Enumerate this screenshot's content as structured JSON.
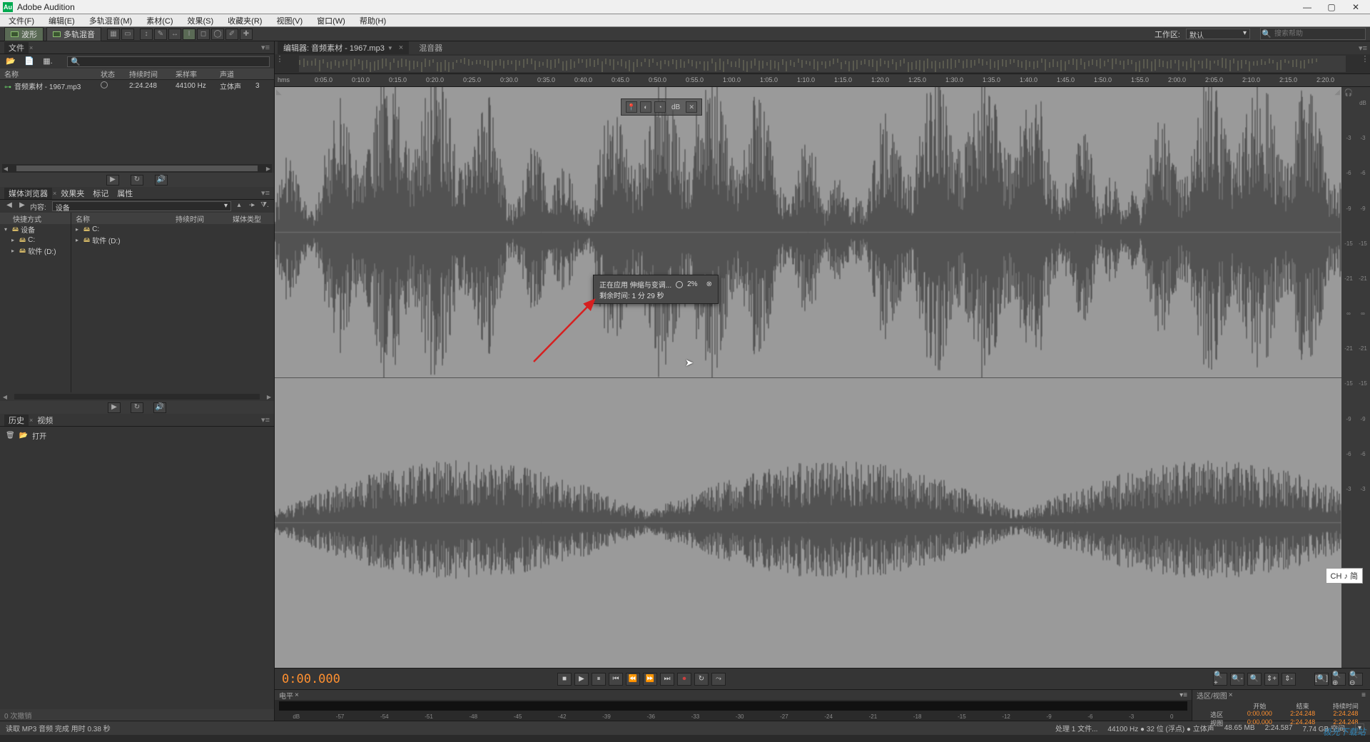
{
  "app": {
    "title": "Adobe Audition",
    "logo": "Au"
  },
  "menu": {
    "items": [
      "文件(F)",
      "编辑(E)",
      "多轨混音(M)",
      "素材(C)",
      "效果(S)",
      "收藏夹(R)",
      "视图(V)",
      "窗口(W)",
      "帮助(H)"
    ]
  },
  "mode": {
    "waveform": "波形",
    "multitrack": "多轨混音",
    "workspace_lbl": "工作区:",
    "workspace_val": "默认",
    "search_ph": "搜索帮助"
  },
  "files": {
    "panel": "文件",
    "cols": {
      "name": "名称",
      "status": "状态",
      "dur": "持续时间",
      "sr": "采样率",
      "ch": "声道"
    },
    "row": {
      "name": "音频素材 - 1967.mp3",
      "dur": "2:24.248",
      "sr": "44100 Hz",
      "ch": "立体声",
      "lvl": "3"
    }
  },
  "mbrowser": {
    "tabs": [
      "媒体浏览器",
      "效果夹",
      "标记",
      "属性"
    ],
    "content_lbl": "内容:",
    "content_val": "设备",
    "tree_hdr": "快捷方式",
    "list_name": "名称",
    "list_dur": "持续时间",
    "list_type": "媒体类型",
    "tree": [
      "设备",
      "C:",
      "软件 (D:)"
    ],
    "list": [
      "C:",
      "软件 (D:)"
    ]
  },
  "history": {
    "tabs": [
      "历史",
      "视频"
    ],
    "item": "打开",
    "undo": "0 次撤销"
  },
  "editor": {
    "title_prefix": "编辑器: ",
    "filename": "音频素材 - 1967.mp3",
    "mixer": "混音器",
    "ruler": [
      "hms",
      "0:05.0",
      "0:10.0",
      "0:15.0",
      "0:20.0",
      "0:25.0",
      "0:30.0",
      "0:35.0",
      "0:40.0",
      "0:45.0",
      "0:50.0",
      "0:55.0",
      "1:00.0",
      "1:05.0",
      "1:10.0",
      "1:15.0",
      "1:20.0",
      "1:25.0",
      "1:30.0",
      "1:35.0",
      "1:40.0",
      "1:45.0",
      "1:50.0",
      "1:55.0",
      "2:00.0",
      "2:05.0",
      "2:10.0",
      "2:15.0",
      "2:20.0"
    ],
    "db_marks": [
      "dB",
      "-3",
      "-6",
      "-9",
      "-15",
      "-21",
      "∞",
      "-21",
      "-15",
      "-9",
      "-6",
      "-3"
    ],
    "hud_txt": "dB"
  },
  "progress": {
    "line1": "正在应用 伸缩与变调...",
    "pct": "2%",
    "line2": "剩余时间: 1 分 29 秒"
  },
  "transport": {
    "time": "0:00.000"
  },
  "levels": {
    "panel": "电平",
    "marks": [
      "dB",
      "-57",
      "-54",
      "-51",
      "-48",
      "-45",
      "-42",
      "-39",
      "-36",
      "-33",
      "-30",
      "-27",
      "-24",
      "-21",
      "-18",
      "-15",
      "-12",
      "-9",
      "-6",
      "-3",
      "0"
    ]
  },
  "selview": {
    "title": "选区/视图",
    "cols": [
      "开始",
      "结束",
      "持续时间"
    ],
    "sel": {
      "lbl": "选区",
      "a": "0:00.000",
      "b": "2:24.248",
      "c": "2:24.248"
    },
    "view": {
      "lbl": "视图",
      "a": "0:00.000",
      "b": "2:24.248",
      "c": "2:24.248"
    }
  },
  "status": {
    "left": "读取 MP3 音频 完成 用时 0.38 秒",
    "items": [
      "处理 1 文件...",
      "44100 Hz ● 32 位 (浮点) ● 立体声",
      "48.65 MB",
      "2:24.587",
      "7.74 GB 空间"
    ]
  },
  "ime": "CH ♪ 简",
  "watermark": "极光下载站"
}
